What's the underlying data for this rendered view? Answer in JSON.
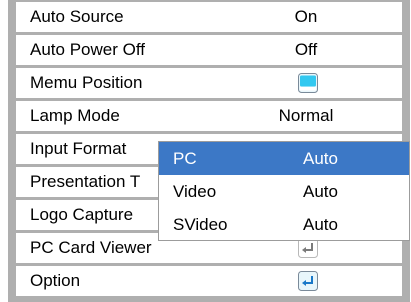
{
  "menu": {
    "items": [
      {
        "label": "Auto Source",
        "value": "On"
      },
      {
        "label": "Auto Power Off",
        "value": "Off"
      },
      {
        "label": "Memu Position",
        "icon": "screen-position-icon"
      },
      {
        "label": "Lamp Mode",
        "value": "Normal"
      },
      {
        "label": "Input Format"
      },
      {
        "label": "Presentation T"
      },
      {
        "label": "Logo Capture"
      },
      {
        "label": "PC Card Viewer",
        "icon": "enter-icon"
      },
      {
        "label": "Option",
        "icon": "enter-icon"
      }
    ]
  },
  "submenu": {
    "selected_index": 0,
    "items": [
      {
        "name": "PC",
        "value": "Auto"
      },
      {
        "name": "Video",
        "value": "Auto"
      },
      {
        "name": "SVideo",
        "value": "Auto"
      }
    ]
  },
  "colors": {
    "selection": "#3c78c6",
    "menu_background": "#afafaf",
    "icon_cyan": "#32c8f0"
  }
}
